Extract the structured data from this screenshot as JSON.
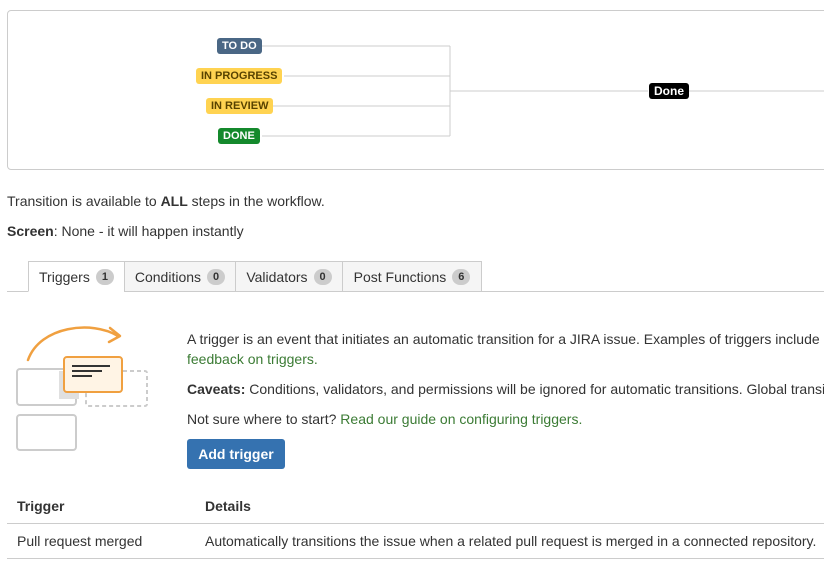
{
  "diagram": {
    "statuses": [
      {
        "label": "TO DO",
        "color": "#4a6785"
      },
      {
        "label": "IN PROGRESS",
        "color": "#ffd351"
      },
      {
        "label": "IN REVIEW",
        "color": "#ffd351"
      },
      {
        "label": "DONE",
        "color": "#14892c"
      }
    ],
    "target": "Done"
  },
  "availability": {
    "prefix": "Transition is available to ",
    "emphasis": "ALL",
    "suffix": " steps in the workflow."
  },
  "screen": {
    "label": "Screen",
    "value": ": None - it will happen instantly"
  },
  "tabs": [
    {
      "label": "Triggers",
      "count": "1",
      "active": true
    },
    {
      "label": "Conditions",
      "count": "0",
      "active": false
    },
    {
      "label": "Validators",
      "count": "0",
      "active": false
    },
    {
      "label": "Post Functions",
      "count": "6",
      "active": false
    }
  ],
  "triggers_panel": {
    "intro": "A trigger is an event that initiates an automatic transition for a JIRA issue. Examples of triggers include",
    "feedback_link": "feedback on triggers.",
    "caveats_label": "Caveats:",
    "caveats_text": " Conditions, validators, and permissions will be ignored for automatic transitions. Global transi",
    "guide_prefix": "Not sure where to start? ",
    "guide_link": "Read our guide on configuring triggers.",
    "add_button": "Add trigger"
  },
  "table": {
    "headers": [
      "Trigger",
      "Details"
    ],
    "rows": [
      [
        "Pull request merged",
        "Automatically transitions the issue when a related pull request is merged in a connected repository."
      ]
    ]
  },
  "colors": {
    "link": "#3b7b34",
    "primary_button": "#3572b0",
    "illustration_accent": "#f0a040"
  }
}
